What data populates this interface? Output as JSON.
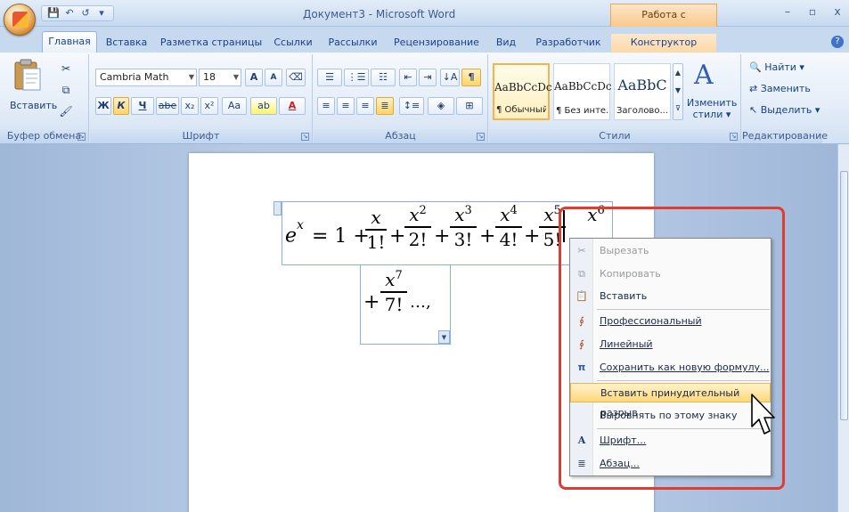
{
  "window": {
    "title": "Документ3 - Microsoft Word",
    "context_title": "Работа с формулами",
    "controls": [
      "–",
      "▫",
      "x"
    ]
  },
  "qat": {
    "save": "💾",
    "undo": "↶",
    "redo": "↺",
    "customize": "▾"
  },
  "tabs": [
    {
      "label": "Главная"
    },
    {
      "label": "Вставка"
    },
    {
      "label": "Разметка страницы"
    },
    {
      "label": "Ссылки"
    },
    {
      "label": "Рассылки"
    },
    {
      "label": "Рецензирование"
    },
    {
      "label": "Вид"
    },
    {
      "label": "Разработчик"
    },
    {
      "label": "Конструктор"
    }
  ],
  "ribbon": {
    "clipboard": {
      "paste_label": "Вставить",
      "group_label": "Буфер обмена"
    },
    "font": {
      "font_name": "Cambria Math",
      "font_size": "18",
      "grow": "A",
      "shrink": "A",
      "bold": "Ж",
      "italic": "К",
      "underline": "Ч",
      "strike": "abe",
      "sub": "x₂",
      "sup": "x²",
      "case": "Aa",
      "highlight": "ab",
      "color": "A",
      "group_label": "Шрифт"
    },
    "paragraph": {
      "group_label": "Абзац",
      "pilcrow": "¶"
    },
    "styles": {
      "items": [
        {
          "sample": "AaBbCcDc",
          "name": "¶ Обычный"
        },
        {
          "sample": "AaBbCcDc",
          "name": "¶ Без инте..."
        },
        {
          "sample": "AaBbC",
          "name": "Заголово..."
        }
      ],
      "change_label_1": "Изменить",
      "change_label_2": "стили",
      "group_label": "Стили"
    },
    "editing": {
      "find": "Найти",
      "replace": "Заменить",
      "select": "Выделить",
      "group_label": "Редактирование"
    }
  },
  "equation": {
    "lhs": "e",
    "lhs_exp": "x",
    "eq_one": "= 1 +",
    "terms": [
      {
        "num": "x",
        "exp": "",
        "den": "1!"
      },
      {
        "num": "x",
        "exp": "2",
        "den": "2!"
      },
      {
        "num": "x",
        "exp": "3",
        "den": "3!"
      },
      {
        "num": "x",
        "exp": "4",
        "den": "4!"
      },
      {
        "num": "x",
        "exp": "5",
        "den": "5!"
      },
      {
        "num": "x",
        "exp": "6",
        "den": ""
      }
    ],
    "line2_term": {
      "num": "x",
      "exp": "7",
      "den": "7!"
    },
    "line2_tail": "…,"
  },
  "context_menu": {
    "items": [
      {
        "label": "Вырезать",
        "icon": "scissors-icon",
        "glyph": "✂",
        "disabled": true
      },
      {
        "label": "Копировать",
        "icon": "copy-icon",
        "glyph": "⧉",
        "disabled": true
      },
      {
        "label": "Вставить",
        "icon": "paste-icon",
        "glyph": "📋",
        "disabled": false
      },
      {
        "label": "Профессиональный",
        "icon": "professional-icon",
        "glyph": "∮",
        "disabled": false
      },
      {
        "label": "Линейный",
        "icon": "linear-icon",
        "glyph": "∮",
        "disabled": false
      },
      {
        "label": "Сохранить как новую формулу...",
        "icon": "save-equation-icon",
        "glyph": "π",
        "disabled": false
      },
      {
        "label": "Вставить принудительный разрыв",
        "icon": "",
        "glyph": "",
        "disabled": false,
        "highlighted": true
      },
      {
        "label": "Выровнять по этому знаку",
        "icon": "",
        "glyph": "",
        "disabled": false
      },
      {
        "label": "Шрифт...",
        "icon": "font-icon",
        "glyph": "A",
        "disabled": false
      },
      {
        "label": "Абзац...",
        "icon": "paragraph-icon",
        "glyph": "≣",
        "disabled": false
      }
    ]
  },
  "colors": {
    "highlight_outline": "#e23b2f",
    "menu_hot": "#ffd87a"
  }
}
